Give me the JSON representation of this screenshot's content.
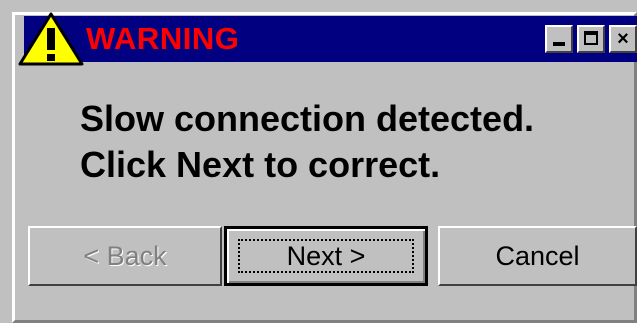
{
  "dialog": {
    "title": "WARNING",
    "title_color": "#ff0000",
    "titlebar_color": "#000080",
    "icon": "warning-triangle-icon",
    "window_controls": {
      "minimize_icon": "minimize-icon",
      "maximize_icon": "maximize-icon",
      "close_icon": "close-icon",
      "close_glyph": "×"
    },
    "message_lines": [
      "Slow connection detected.",
      "Click Next to correct."
    ],
    "buttons": {
      "back_label": "< Back",
      "back_disabled": true,
      "next_label": "Next >",
      "next_focused": true,
      "cancel_label": "Cancel"
    }
  }
}
